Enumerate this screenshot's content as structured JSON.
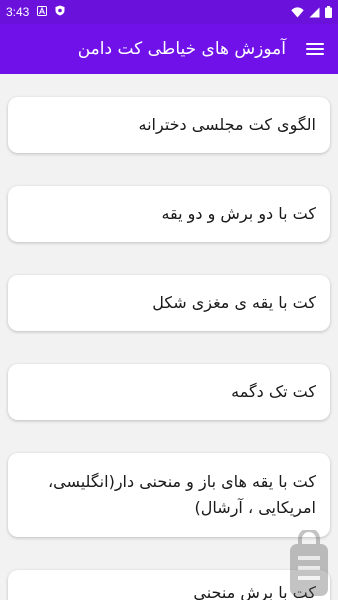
{
  "status_bar": {
    "time": "3:43",
    "icons": [
      "a-notification-icon",
      "shield-notification-icon",
      "wifi-icon",
      "signal-icon",
      "battery-icon"
    ]
  },
  "app_bar": {
    "title": "آموزش های خیاطی کت دامن",
    "menu_icon": "hamburger-menu-icon"
  },
  "items": [
    {
      "label": "الگوی کت مجلسی دخترانه"
    },
    {
      "label": "کت با دو برش و دو یقه"
    },
    {
      "label": "کت با یقه ی مغزی شکل"
    },
    {
      "label": "کت تک دگمه"
    },
    {
      "label": "کت با یقه های باز و منحنی دار(انگلیسی، امریکایی ، آرشال)"
    },
    {
      "label": "کت با برش منحنی"
    }
  ],
  "colors": {
    "status_bar": "#6a11dc",
    "app_bar": "#7011ea",
    "background": "#f2f2f2",
    "card": "#ffffff",
    "text": "#1a1a1a"
  }
}
